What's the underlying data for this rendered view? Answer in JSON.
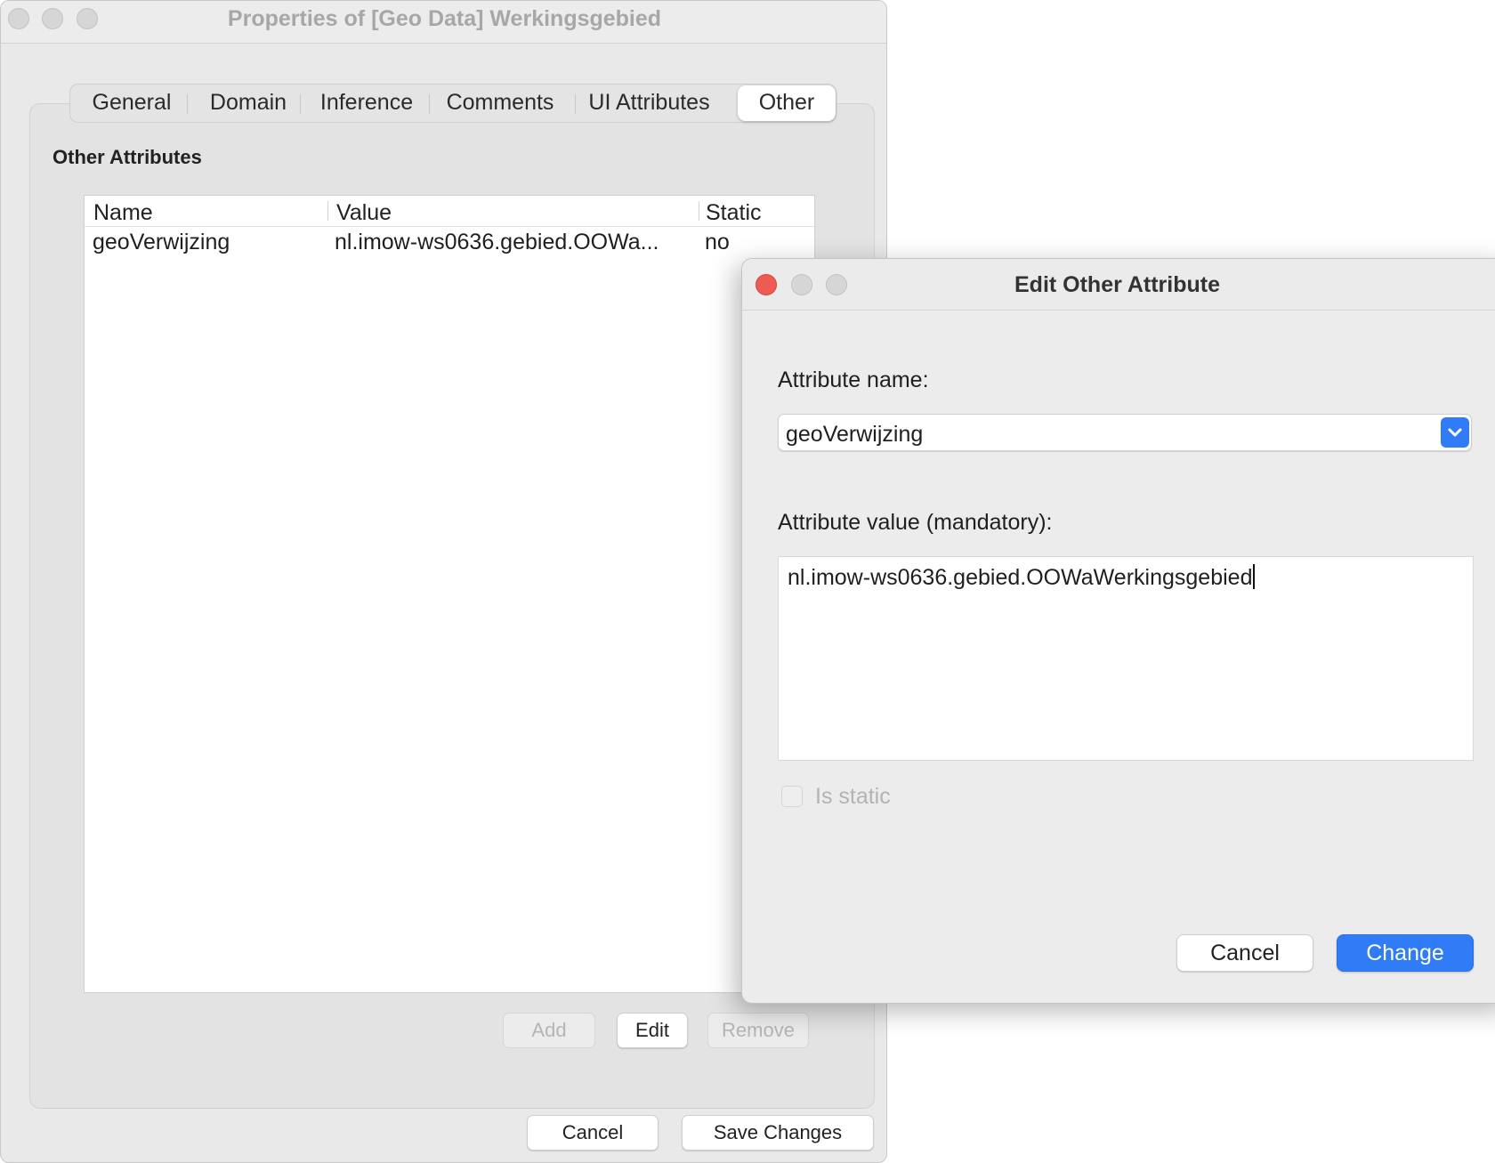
{
  "properties_window": {
    "title": "Properties of [Geo Data] Werkingsgebied",
    "tabs": [
      {
        "label": "General"
      },
      {
        "label": "Domain"
      },
      {
        "label": "Inference"
      },
      {
        "label": "Comments"
      },
      {
        "label": "UI Attributes"
      },
      {
        "label": "Other",
        "active": true
      }
    ],
    "section_title": "Other Attributes",
    "table": {
      "columns": [
        "Name",
        "Value",
        "Static"
      ],
      "rows": [
        {
          "name": "geoVerwijzing",
          "value": "nl.imow-ws0636.gebied.OOWa...",
          "static": "no"
        }
      ]
    },
    "buttons": {
      "add": "Add",
      "edit": "Edit",
      "remove": "Remove",
      "cancel": "Cancel",
      "save": "Save Changes"
    }
  },
  "edit_dialog": {
    "title": "Edit Other Attribute",
    "attribute_name_label": "Attribute name:",
    "attribute_name_value": "geoVerwijzing",
    "attribute_value_label": "Attribute value (mandatory):",
    "attribute_value": "nl.imow-ws0636.gebied.OOWaWerkingsgebied",
    "is_static_label": "Is static",
    "is_static_checked": false,
    "buttons": {
      "cancel": "Cancel",
      "change": "Change"
    }
  },
  "colors": {
    "accent": "#2f7cf6",
    "close_button": "#ee5b53",
    "window_bg": "#ececec"
  }
}
